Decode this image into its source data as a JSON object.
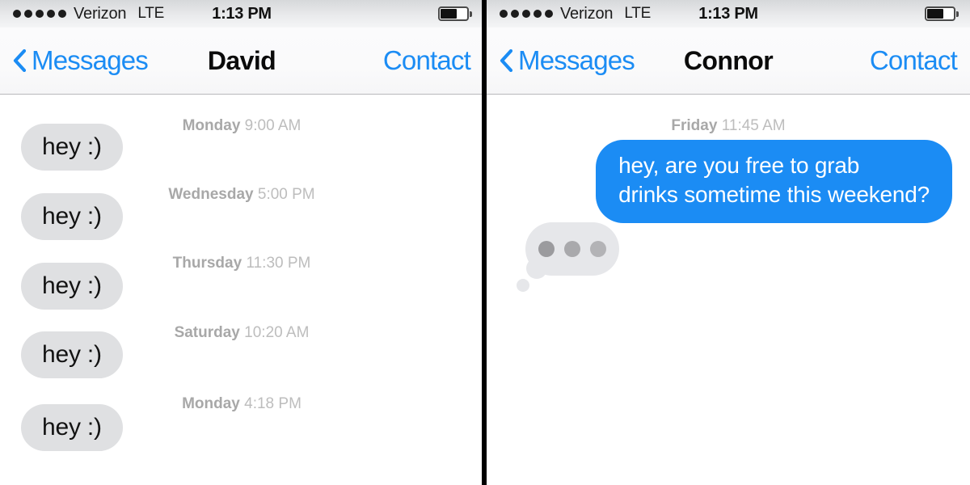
{
  "colors": {
    "accent_blue": "#1b8cf4",
    "incoming_bubble": "#dfe0e2",
    "typing_bubble": "#e6e7ea",
    "timestamp_grey": "#b6b6b6",
    "divider_black": "#000000"
  },
  "status_bar": {
    "signal_dots": 5,
    "carrier": "Verizon",
    "network": "LTE",
    "time": "1:13 PM",
    "battery_level_percent": 62,
    "battery_icon": "battery-icon"
  },
  "panels": [
    {
      "nav": {
        "back_icon": "chevron-left-icon",
        "back_label": "Messages",
        "title": "David",
        "action_label": "Contact"
      },
      "thread": {
        "timestamps": [
          {
            "day": "Monday",
            "time": "9:00 AM"
          },
          {
            "day": "Wednesday",
            "time": "5:00 PM"
          },
          {
            "day": "Thursday",
            "time": "11:30 PM"
          },
          {
            "day": "Saturday",
            "time": "10:20 AM"
          },
          {
            "day": "Monday",
            "time": "4:18 PM"
          }
        ],
        "messages": [
          {
            "text": "hey :)",
            "direction": "incoming"
          },
          {
            "text": "hey :)",
            "direction": "incoming"
          },
          {
            "text": "hey :)",
            "direction": "incoming"
          },
          {
            "text": "hey :)",
            "direction": "incoming"
          },
          {
            "text": "hey :)",
            "direction": "incoming"
          }
        ],
        "typing_indicator": false
      }
    },
    {
      "nav": {
        "back_icon": "chevron-left-icon",
        "back_label": "Messages",
        "title": "Connor",
        "action_label": "Contact"
      },
      "thread": {
        "timestamps": [
          {
            "day": "Friday",
            "time": "11:45 AM"
          }
        ],
        "messages": [
          {
            "text": "hey, are you free to grab drinks sometime this weekend?",
            "line1": "hey, are you free to grab",
            "line2": "drinks sometime this weekend?",
            "direction": "outgoing"
          }
        ],
        "typing_indicator": true,
        "typing_dots": 3
      }
    }
  ]
}
